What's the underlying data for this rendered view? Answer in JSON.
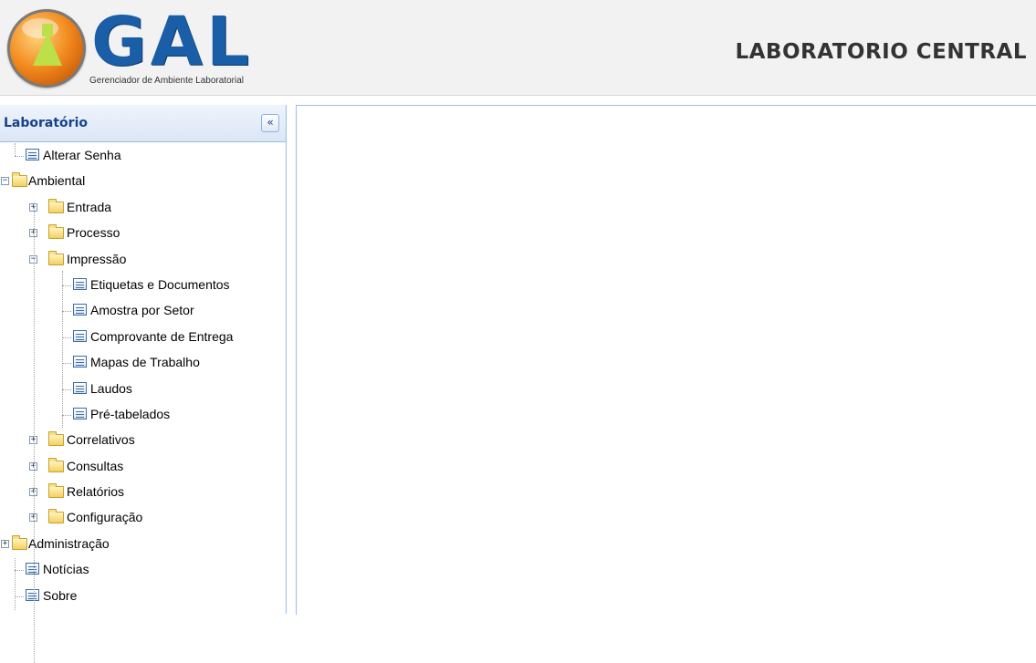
{
  "header": {
    "logo_text": "GAL",
    "logo_subtitle": "Gerenciador de Ambiente Laboratorial",
    "title": "LABORATORIO CENTRAL"
  },
  "sidebar": {
    "title": "Laboratório",
    "collapse_icon": "«",
    "tree": [
      {
        "label": "Alterar Senha",
        "type": "leaf",
        "level": 1
      },
      {
        "label": "Ambiental",
        "type": "folder",
        "level": 0,
        "expanded": true
      },
      {
        "label": "Entrada",
        "type": "folder",
        "level": 1,
        "expanded": false
      },
      {
        "label": "Processo",
        "type": "folder",
        "level": 1,
        "expanded": false
      },
      {
        "label": "Impressão",
        "type": "folder",
        "level": 1,
        "expanded": true
      },
      {
        "label": "Etiquetas e Documentos",
        "type": "leaf",
        "level": 2
      },
      {
        "label": "Amostra por Setor",
        "type": "leaf",
        "level": 2
      },
      {
        "label": "Comprovante de Entrega",
        "type": "leaf",
        "level": 2
      },
      {
        "label": "Mapas de Trabalho",
        "type": "leaf",
        "level": 2
      },
      {
        "label": "Laudos",
        "type": "leaf",
        "level": 2
      },
      {
        "label": "Pré-tabelados",
        "type": "leaf",
        "level": 2
      },
      {
        "label": "Correlativos",
        "type": "folder",
        "level": 1,
        "expanded": false
      },
      {
        "label": "Consultas",
        "type": "folder",
        "level": 1,
        "expanded": false
      },
      {
        "label": "Relatórios",
        "type": "folder",
        "level": 1,
        "expanded": false
      },
      {
        "label": "Configuração",
        "type": "folder",
        "level": 1,
        "expanded": false
      },
      {
        "label": "Administração",
        "type": "folder",
        "level": 0,
        "expanded": false
      },
      {
        "label": "Notícias",
        "type": "leaf",
        "level": 1
      },
      {
        "label": "Sobre",
        "type": "leaf",
        "level": 1
      }
    ]
  },
  "colors": {
    "brand_blue": "#1a5ea8",
    "panel_header_text": "#15428b",
    "panel_border": "#99bbe8",
    "folder_yellow": "#f3d061"
  }
}
